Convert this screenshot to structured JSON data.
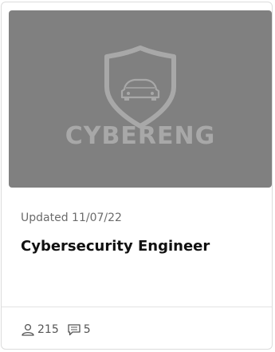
{
  "card": {
    "thumbnail": {
      "logo_text": "CYBERENG",
      "logo_icon": "shield-car-icon",
      "background": "#808080"
    },
    "updated_text": "Updated 11/07/22",
    "title": "Cybersecurity Engineer",
    "stats": {
      "members_icon": "user-icon",
      "members": "215",
      "comments_icon": "comment-icon",
      "comments": "5"
    }
  }
}
